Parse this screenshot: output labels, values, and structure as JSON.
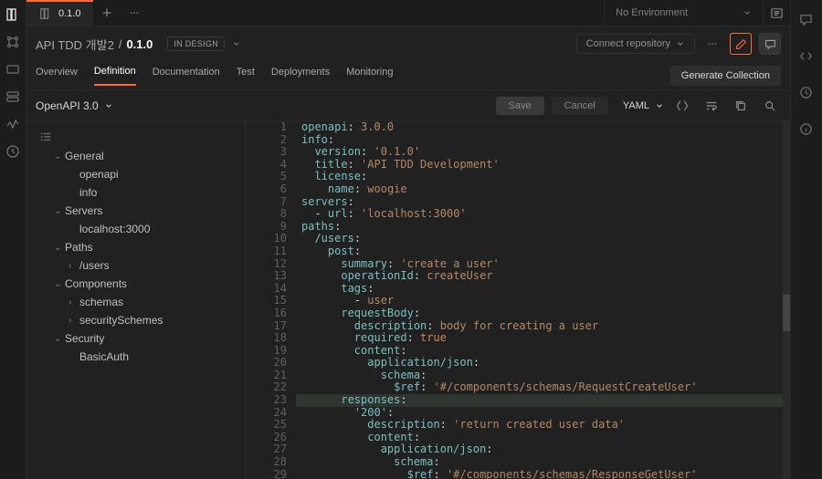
{
  "tab": {
    "label": "0.1.0"
  },
  "env": {
    "placeholder": "No Environment"
  },
  "breadcrumb": {
    "parent": "API TDD 개발2",
    "sep": "/",
    "current": "0.1.0"
  },
  "badge": "IN DESIGN",
  "connect_repo": "Connect repository",
  "navtabs": [
    "Overview",
    "Definition",
    "Documentation",
    "Test",
    "Deployments",
    "Monitoring"
  ],
  "navtab_active": 1,
  "generate_collection": "Generate Collection",
  "schema": "OpenAPI 3.0",
  "save": "Save",
  "cancel": "Cancel",
  "lang": "YAML",
  "outline": [
    {
      "label": "General",
      "depth": 0,
      "caret": "v"
    },
    {
      "label": "openapi",
      "depth": 1
    },
    {
      "label": "info",
      "depth": 1
    },
    {
      "label": "Servers",
      "depth": 0,
      "caret": "v"
    },
    {
      "label": "localhost:3000",
      "depth": 1
    },
    {
      "label": "Paths",
      "depth": 0,
      "caret": "v"
    },
    {
      "label": "/users",
      "depth": 1,
      "caret": ">"
    },
    {
      "label": "Components",
      "depth": 0,
      "caret": "v"
    },
    {
      "label": "schemas",
      "depth": 1,
      "caret": ">"
    },
    {
      "label": "securitySchemes",
      "depth": 1,
      "caret": ">"
    },
    {
      "label": "Security",
      "depth": 0,
      "caret": "v"
    },
    {
      "label": "BasicAuth",
      "depth": 1
    }
  ],
  "code": [
    {
      "n": 1,
      "t": [
        [
          "k",
          "openapi"
        ],
        [
          "p",
          ": "
        ],
        [
          "s",
          "3.0.0"
        ]
      ]
    },
    {
      "n": 2,
      "t": [
        [
          "k",
          "info"
        ],
        [
          "p",
          ":"
        ]
      ]
    },
    {
      "n": 3,
      "t": [
        [
          "p",
          "  "
        ],
        [
          "k",
          "version"
        ],
        [
          "p",
          ": "
        ],
        [
          "s",
          "'0.1.0'"
        ]
      ]
    },
    {
      "n": 4,
      "t": [
        [
          "p",
          "  "
        ],
        [
          "k",
          "title"
        ],
        [
          "p",
          ": "
        ],
        [
          "s",
          "'API TDD Development'"
        ]
      ]
    },
    {
      "n": 5,
      "t": [
        [
          "p",
          "  "
        ],
        [
          "k",
          "license"
        ],
        [
          "p",
          ":"
        ]
      ]
    },
    {
      "n": 6,
      "t": [
        [
          "p",
          "    "
        ],
        [
          "k",
          "name"
        ],
        [
          "p",
          ": "
        ],
        [
          "s",
          "woogie"
        ]
      ]
    },
    {
      "n": 7,
      "t": [
        [
          "k",
          "servers"
        ],
        [
          "p",
          ":"
        ]
      ]
    },
    {
      "n": 8,
      "t": [
        [
          "p",
          "  - "
        ],
        [
          "k",
          "url"
        ],
        [
          "p",
          ": "
        ],
        [
          "s",
          "'localhost:3000'"
        ]
      ]
    },
    {
      "n": 9,
      "t": [
        [
          "k",
          "paths"
        ],
        [
          "p",
          ":"
        ]
      ]
    },
    {
      "n": 10,
      "t": [
        [
          "p",
          "  "
        ],
        [
          "k",
          "/users"
        ],
        [
          "p",
          ":"
        ]
      ]
    },
    {
      "n": 11,
      "t": [
        [
          "p",
          "    "
        ],
        [
          "k",
          "post"
        ],
        [
          "p",
          ":"
        ]
      ]
    },
    {
      "n": 12,
      "t": [
        [
          "p",
          "      "
        ],
        [
          "k",
          "summary"
        ],
        [
          "p",
          ": "
        ],
        [
          "s",
          "'create a user'"
        ]
      ]
    },
    {
      "n": 13,
      "t": [
        [
          "p",
          "      "
        ],
        [
          "k",
          "operationId"
        ],
        [
          "p",
          ": "
        ],
        [
          "s",
          "createUser"
        ]
      ]
    },
    {
      "n": 14,
      "t": [
        [
          "p",
          "      "
        ],
        [
          "k",
          "tags"
        ],
        [
          "p",
          ":"
        ]
      ]
    },
    {
      "n": 15,
      "t": [
        [
          "p",
          "        - "
        ],
        [
          "s",
          "user"
        ]
      ]
    },
    {
      "n": 16,
      "t": [
        [
          "p",
          "      "
        ],
        [
          "k",
          "requestBody"
        ],
        [
          "p",
          ":"
        ]
      ]
    },
    {
      "n": 17,
      "t": [
        [
          "p",
          "        "
        ],
        [
          "k",
          "description"
        ],
        [
          "p",
          ": "
        ],
        [
          "s",
          "body for creating a user"
        ]
      ]
    },
    {
      "n": 18,
      "t": [
        [
          "p",
          "        "
        ],
        [
          "k",
          "required"
        ],
        [
          "p",
          ": "
        ],
        [
          "b",
          "true"
        ]
      ]
    },
    {
      "n": 19,
      "t": [
        [
          "p",
          "        "
        ],
        [
          "k",
          "content"
        ],
        [
          "p",
          ":"
        ]
      ]
    },
    {
      "n": 20,
      "t": [
        [
          "p",
          "          "
        ],
        [
          "k",
          "application/json"
        ],
        [
          "p",
          ":"
        ]
      ]
    },
    {
      "n": 21,
      "t": [
        [
          "p",
          "            "
        ],
        [
          "k",
          "schema"
        ],
        [
          "p",
          ":"
        ]
      ]
    },
    {
      "n": 22,
      "t": [
        [
          "p",
          "              "
        ],
        [
          "k",
          "$ref"
        ],
        [
          "p",
          ": "
        ],
        [
          "s",
          "'#/components/schemas/RequestCreateUser'"
        ]
      ]
    },
    {
      "n": 23,
      "hl": true,
      "t": [
        [
          "p",
          "      "
        ],
        [
          "k",
          "responses"
        ],
        [
          "p",
          ":"
        ]
      ]
    },
    {
      "n": 24,
      "t": [
        [
          "p",
          "        "
        ],
        [
          "k",
          "'200'"
        ],
        [
          "p",
          ":"
        ]
      ]
    },
    {
      "n": 25,
      "t": [
        [
          "p",
          "          "
        ],
        [
          "k",
          "description"
        ],
        [
          "p",
          ": "
        ],
        [
          "s",
          "'return created user data'"
        ]
      ]
    },
    {
      "n": 26,
      "t": [
        [
          "p",
          "          "
        ],
        [
          "k",
          "content"
        ],
        [
          "p",
          ":"
        ]
      ]
    },
    {
      "n": 27,
      "t": [
        [
          "p",
          "            "
        ],
        [
          "k",
          "application/json"
        ],
        [
          "p",
          ":"
        ]
      ]
    },
    {
      "n": 28,
      "t": [
        [
          "p",
          "              "
        ],
        [
          "k",
          "schema"
        ],
        [
          "p",
          ":"
        ]
      ]
    },
    {
      "n": 29,
      "t": [
        [
          "p",
          "                "
        ],
        [
          "k",
          "$ref"
        ],
        [
          "p",
          ": "
        ],
        [
          "s",
          "'#/components/schemas/ResponseGetUser'"
        ]
      ]
    }
  ]
}
